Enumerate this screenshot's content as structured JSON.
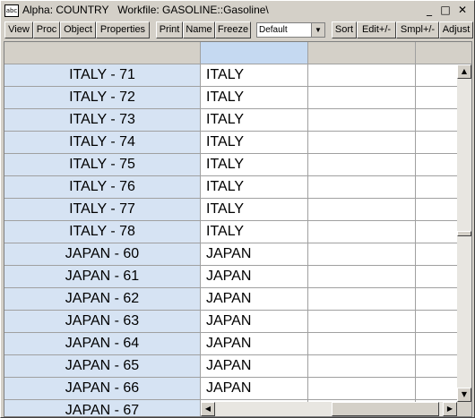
{
  "window": {
    "title": "Alpha: COUNTRY   Workfile: GASOLINE::Gasoline\\",
    "icon_label": "abc",
    "minimize": "_",
    "maximize": "□",
    "close": "✕"
  },
  "toolbar": {
    "view": "View",
    "proc": "Proc",
    "object": "Object",
    "properties": "Properties",
    "print": "Print",
    "name": "Name",
    "freeze": "Freeze",
    "format_select": "Default",
    "sort": "Sort",
    "edit": "Edit+/-",
    "smpl": "Smpl+/-",
    "adjust": "Adjust"
  },
  "rows": [
    {
      "label": "ITALY - 71",
      "value": "ITALY"
    },
    {
      "label": "ITALY - 72",
      "value": "ITALY"
    },
    {
      "label": "ITALY - 73",
      "value": "ITALY"
    },
    {
      "label": "ITALY - 74",
      "value": "ITALY"
    },
    {
      "label": "ITALY - 75",
      "value": "ITALY"
    },
    {
      "label": "ITALY - 76",
      "value": "ITALY"
    },
    {
      "label": "ITALY - 77",
      "value": "ITALY"
    },
    {
      "label": "ITALY - 78",
      "value": "ITALY"
    },
    {
      "label": "JAPAN - 60",
      "value": "JAPAN"
    },
    {
      "label": "JAPAN - 61",
      "value": "JAPAN"
    },
    {
      "label": "JAPAN - 62",
      "value": "JAPAN"
    },
    {
      "label": "JAPAN - 63",
      "value": "JAPAN"
    },
    {
      "label": "JAPAN - 64",
      "value": "JAPAN"
    },
    {
      "label": "JAPAN - 65",
      "value": "JAPAN"
    },
    {
      "label": "JAPAN - 66",
      "value": "JAPAN"
    },
    {
      "label": "JAPAN - 67",
      "value": ""
    }
  ],
  "colors": {
    "label_bg": "#d6e3f3",
    "header_selected": "#c5d9f1"
  }
}
